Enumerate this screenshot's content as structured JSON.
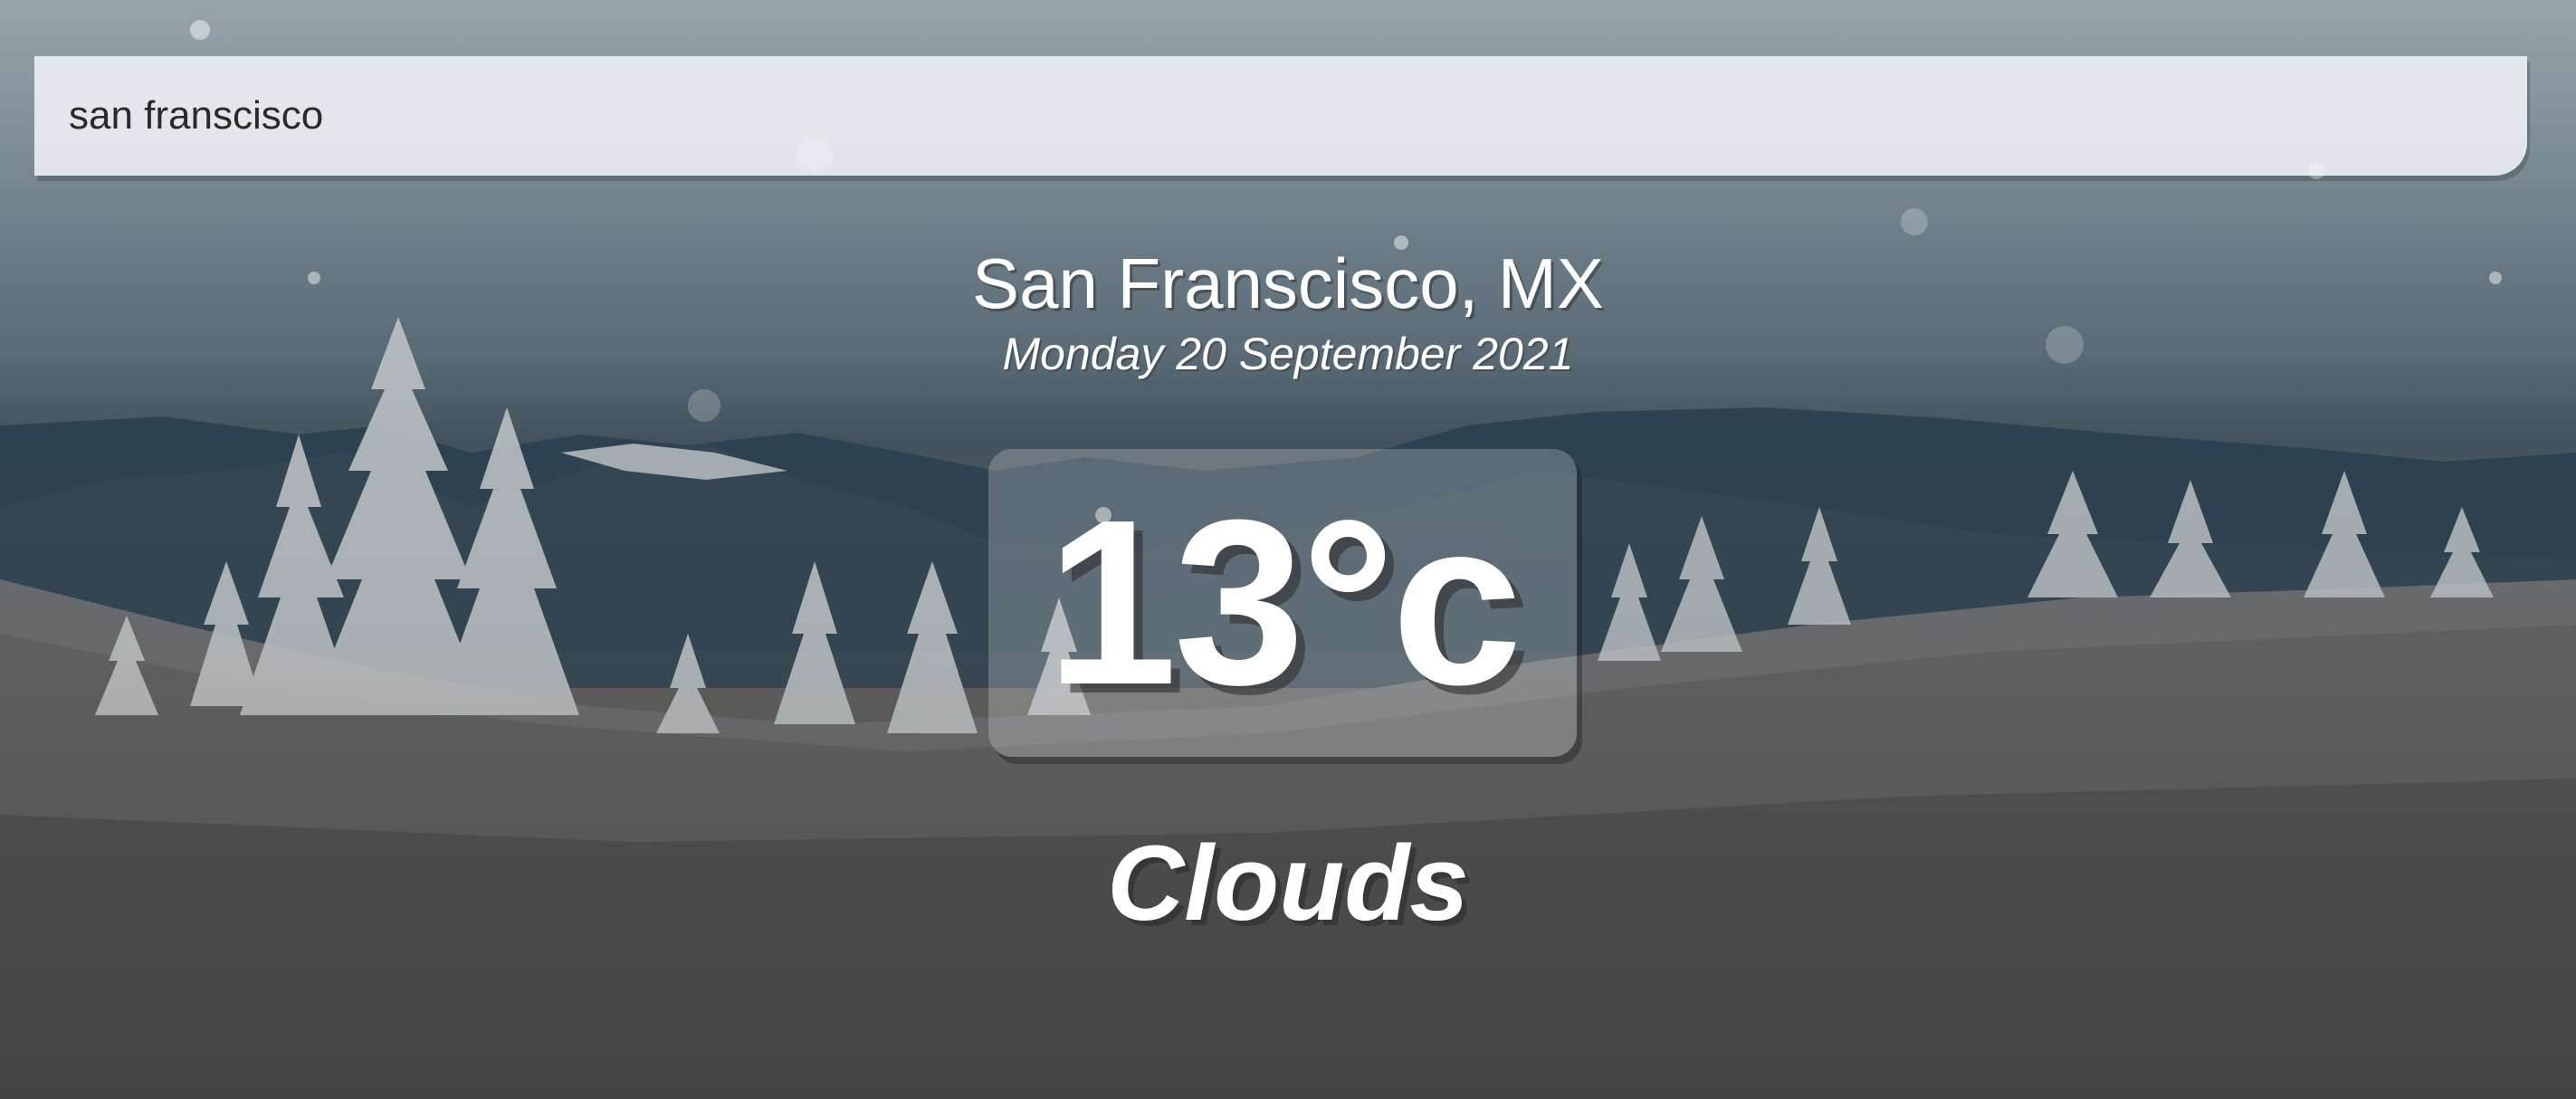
{
  "search": {
    "value": "san franscisco"
  },
  "weather": {
    "location": "San Franscisco, MX",
    "date": "Monday 20 September 2021",
    "temperature": "13°c",
    "condition": "Clouds"
  },
  "background": {
    "description_icon": "snowy-mountain-forest-image"
  }
}
